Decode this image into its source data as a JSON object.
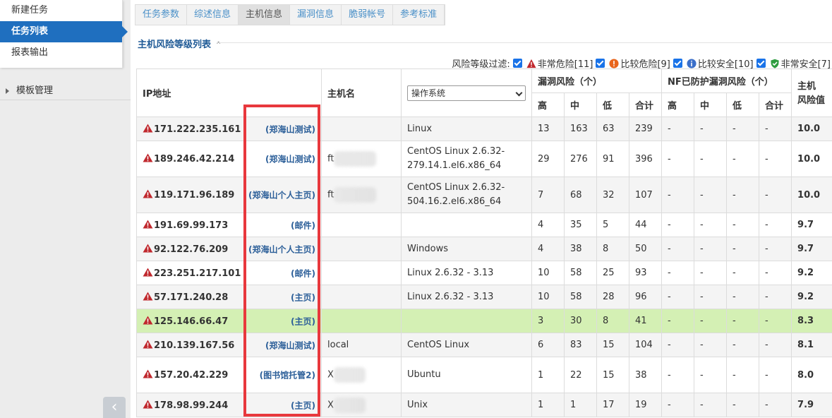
{
  "sidebar": {
    "menu": [
      {
        "label": "新建任务"
      },
      {
        "label": "任务列表"
      },
      {
        "label": "报表输出"
      }
    ],
    "template_group": "模板管理"
  },
  "tabs": [
    "任务参数",
    "综述信息",
    "主机信息",
    "漏洞信息",
    "脆弱帐号",
    "参考标准"
  ],
  "active_tab": "主机信息",
  "section_title": "主机风险等级列表",
  "filter": {
    "label": "风险等级过滤:",
    "options": [
      {
        "label": "非常危险[11]",
        "icon": "warning-triangle-icon",
        "checked": true
      },
      {
        "label": "比较危险[9]",
        "icon": "exclamation-circle-icon",
        "checked": true
      },
      {
        "label": "比较安全[10]",
        "icon": "info-circle-icon",
        "checked": true
      },
      {
        "label": "非常安全[7]",
        "icon": "shield-check-icon",
        "checked": true
      }
    ]
  },
  "table": {
    "headers": {
      "ip": "IP地址",
      "hostname": "主机名",
      "os_select": "操作系统",
      "vuln_risk": "漏洞风险（个）",
      "nf_risk": "NF已防护漏洞风险（个）",
      "host_risk_line1": "主机",
      "host_risk_line2": "风险值",
      "high": "高",
      "mid": "中",
      "low": "低",
      "total": "合计"
    },
    "rows": [
      {
        "ip": "171.222.235.161",
        "tag": "(郑海山测试)",
        "hostname": "",
        "os": "Linux",
        "high": "13",
        "mid": "163",
        "low": "63",
        "total": "239",
        "nf_high": "-",
        "nf_mid": "-",
        "nf_low": "-",
        "nf_total": "-",
        "score": "10.0"
      },
      {
        "ip": "189.246.42.214",
        "tag": "(郑海山测试)",
        "hostname": "ft",
        "os": "CentOS Linux 2.6.32-279.14.1.el6.x86_64",
        "high": "29",
        "mid": "276",
        "low": "91",
        "total": "396",
        "nf_high": "-",
        "nf_mid": "-",
        "nf_low": "-",
        "nf_total": "-",
        "score": "10.0"
      },
      {
        "ip": "119.171.96.189",
        "tag": "(郑海山个人主页)",
        "hostname": "ft",
        "os": "CentOS Linux 2.6.32-504.16.2.el6.x86_64",
        "high": "7",
        "mid": "68",
        "low": "32",
        "total": "107",
        "nf_high": "-",
        "nf_mid": "-",
        "nf_low": "-",
        "nf_total": "-",
        "score": "10.0"
      },
      {
        "ip": "191.69.99.173",
        "tag": "(邮件)",
        "hostname": "",
        "os": "",
        "high": "4",
        "mid": "35",
        "low": "5",
        "total": "44",
        "nf_high": "-",
        "nf_mid": "-",
        "nf_low": "-",
        "nf_total": "-",
        "score": "9.7"
      },
      {
        "ip": "92.122.76.209",
        "tag": "(郑海山个人主页)",
        "hostname": "",
        "os": "Windows",
        "high": "4",
        "mid": "38",
        "low": "8",
        "total": "50",
        "nf_high": "-",
        "nf_mid": "-",
        "nf_low": "-",
        "nf_total": "-",
        "score": "9.7"
      },
      {
        "ip": "223.251.217.101",
        "tag": "(邮件)",
        "hostname": "",
        "os": "Linux 2.6.32 - 3.13",
        "high": "10",
        "mid": "58",
        "low": "25",
        "total": "93",
        "nf_high": "-",
        "nf_mid": "-",
        "nf_low": "-",
        "nf_total": "-",
        "score": "9.2"
      },
      {
        "ip": "57.171.240.28",
        "tag": "(主页)",
        "hostname": "",
        "os": "Linux 2.6.32 - 3.13",
        "high": "10",
        "mid": "58",
        "low": "28",
        "total": "96",
        "nf_high": "-",
        "nf_mid": "-",
        "nf_low": "-",
        "nf_total": "-",
        "score": "9.2"
      },
      {
        "ip": "125.146.66.47",
        "tag": "(主页)",
        "hostname": "",
        "os": "",
        "high": "3",
        "mid": "30",
        "low": "8",
        "total": "41",
        "nf_high": "-",
        "nf_mid": "-",
        "nf_low": "-",
        "nf_total": "-",
        "score": "8.3"
      },
      {
        "ip": "210.139.167.56",
        "tag": "(郑海山测试)",
        "hostname": "local",
        "os": "CentOS Linux",
        "high": "6",
        "mid": "83",
        "low": "15",
        "total": "104",
        "nf_high": "-",
        "nf_mid": "-",
        "nf_low": "-",
        "nf_total": "-",
        "score": "8.1"
      },
      {
        "ip": "157.20.42.229",
        "tag": "(图书馆托管2)",
        "hostname": "X",
        "os": "Ubuntu",
        "high": "1",
        "mid": "22",
        "low": "15",
        "total": "38",
        "nf_high": "-",
        "nf_mid": "-",
        "nf_low": "-",
        "nf_total": "-",
        "score": "8.0"
      },
      {
        "ip": "178.98.99.244",
        "tag": "(主页)",
        "hostname": "X",
        "os": "Unix",
        "high": "1",
        "mid": "1",
        "low": "17",
        "total": "19",
        "nf_high": "-",
        "nf_mid": "-",
        "nf_low": "-",
        "nf_total": "-",
        "score": "7.9"
      }
    ]
  },
  "colors": {
    "accent": "#1f6fbf",
    "ip_text": "#2c5f99",
    "highlight_row": "#d4f0b4",
    "danger": "#c0282d",
    "annotation_box": "#e8383d"
  }
}
